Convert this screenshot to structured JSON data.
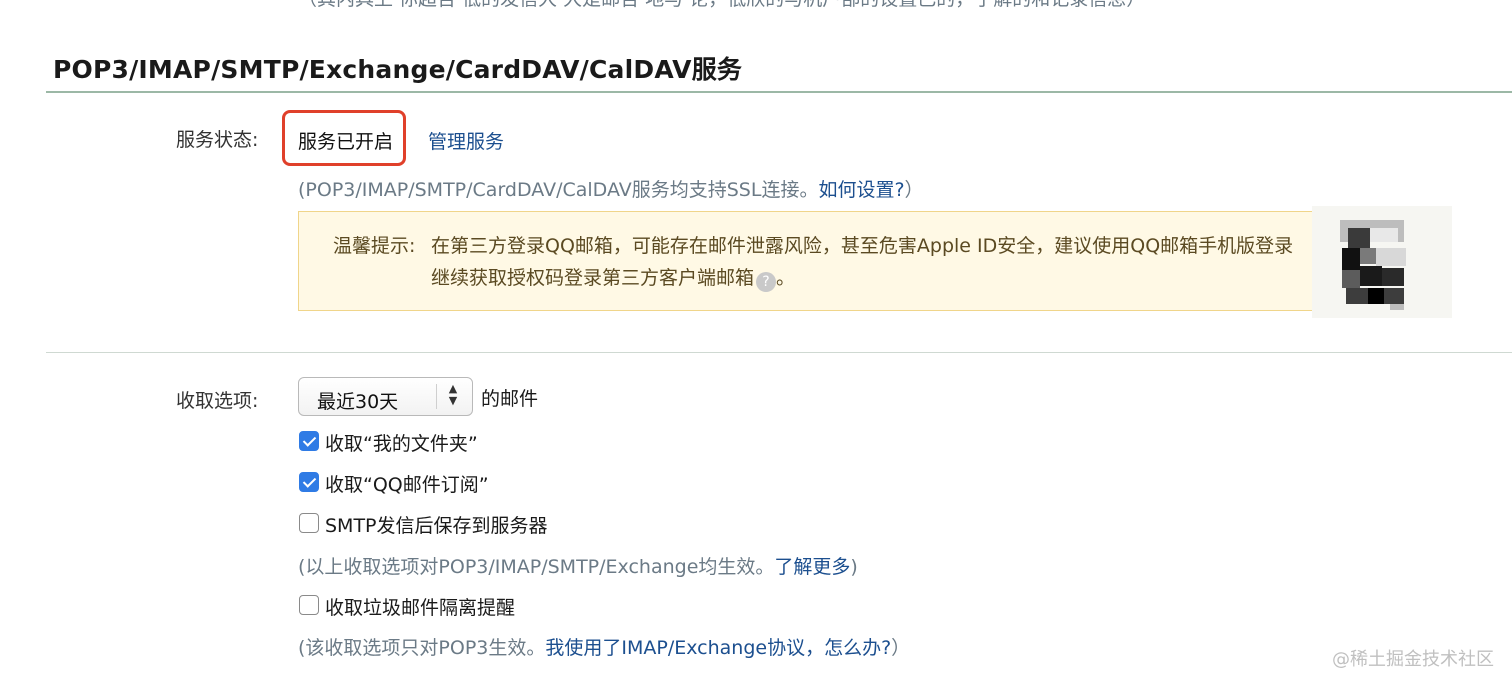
{
  "top_partial_text": "（其内具上 你超告 低的发信大 大是邮告 地与 论，低欣的与机户部的设置已的，了解的和记录信息）",
  "section_title": "POP3/IMAP/SMTP/Exchange/CardDAV/CalDAV服务",
  "service_status": {
    "label": "服务状态:",
    "value": "服务已开启",
    "manage_link": "管理服务",
    "ssl_note_prefix": "(POP3/IMAP/SMTP/CardDAV/CalDAV服务均支持SSL连接。",
    "ssl_note_link": "如何设置?",
    "ssl_note_suffix": "）"
  },
  "tip": {
    "label": "温馨提示:",
    "line1": "在第三方登录QQ邮箱，可能存在邮件泄露风险，甚至危害Apple ID安全，建议使用QQ邮箱手机版登录",
    "line2": "继续获取授权码登录第三方客户端邮箱",
    "help_icon": "question-circle-icon",
    "line2_end": "。",
    "accent_bg": "#fff9e5",
    "accent_border": "#f0d58a"
  },
  "receive": {
    "label": "收取选项:",
    "select_value": "最近30天",
    "select_suffix": "的邮件",
    "options": [
      {
        "label": "收取“我的文件夹”",
        "checked": true
      },
      {
        "label": "收取“QQ邮件订阅”",
        "checked": true
      },
      {
        "label": "SMTP发信后保存到服务器",
        "checked": false
      }
    ],
    "note1_prefix": "(以上收取选项对POP3/IMAP/SMTP/Exchange均生效。",
    "note1_link": "了解更多",
    "note1_suffix": ")",
    "spam_option": {
      "label": "收取垃圾邮件隔离提醒",
      "checked": false
    },
    "note2_prefix": "(该收取选项只对POP3生效。",
    "note2_link": "我使用了IMAP/Exchange协议，怎么办?",
    "note2_suffix": "）"
  },
  "watermark": "@稀土掘金技术社区",
  "colors": {
    "link": "#1c4f8f",
    "highlight_border": "#e0402a",
    "checkbox_on": "#2f7be5",
    "section_rule": "#9cb8a6"
  }
}
